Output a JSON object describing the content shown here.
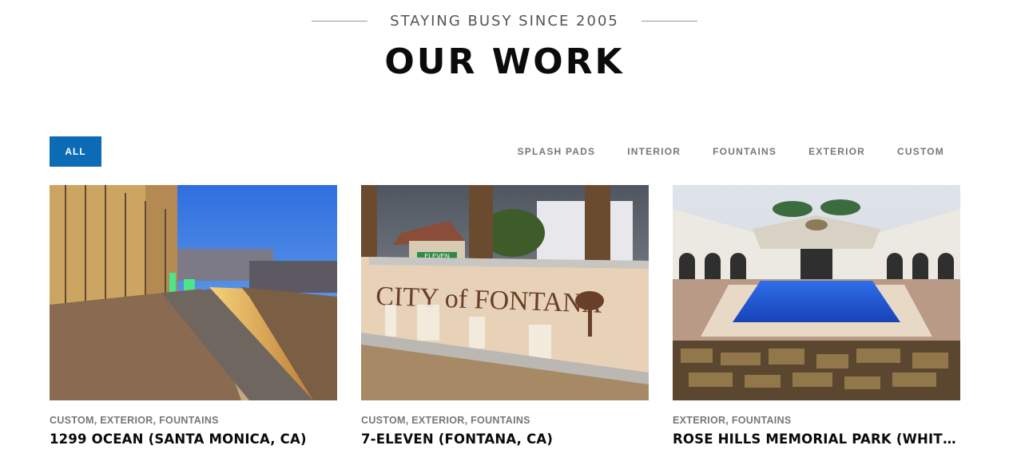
{
  "header": {
    "eyebrow": "STAYING BUSY SINCE 2005",
    "title": "OUR WORK"
  },
  "filters": {
    "active": "ALL",
    "items": [
      "SPLASH PADS",
      "INTERIOR",
      "FOUNTAINS",
      "EXTERIOR",
      "CUSTOM"
    ]
  },
  "projects": [
    {
      "categories": "CUSTOM, EXTERIOR, FOUNTAINS",
      "title": "1299 OCEAN (SANTA MONICA, CA)"
    },
    {
      "categories": "CUSTOM, EXTERIOR, FOUNTAINS",
      "title": "7-ELEVEN (FONTANA, CA)",
      "sign_text": "CITY of FONTANA",
      "store_sign": "ELEVEN"
    },
    {
      "categories": "EXTERIOR, FOUNTAINS",
      "title": "ROSE HILLS MEMORIAL PARK (WHITTIER, CA)"
    }
  ],
  "colors": {
    "accent": "#0c6bb5"
  }
}
